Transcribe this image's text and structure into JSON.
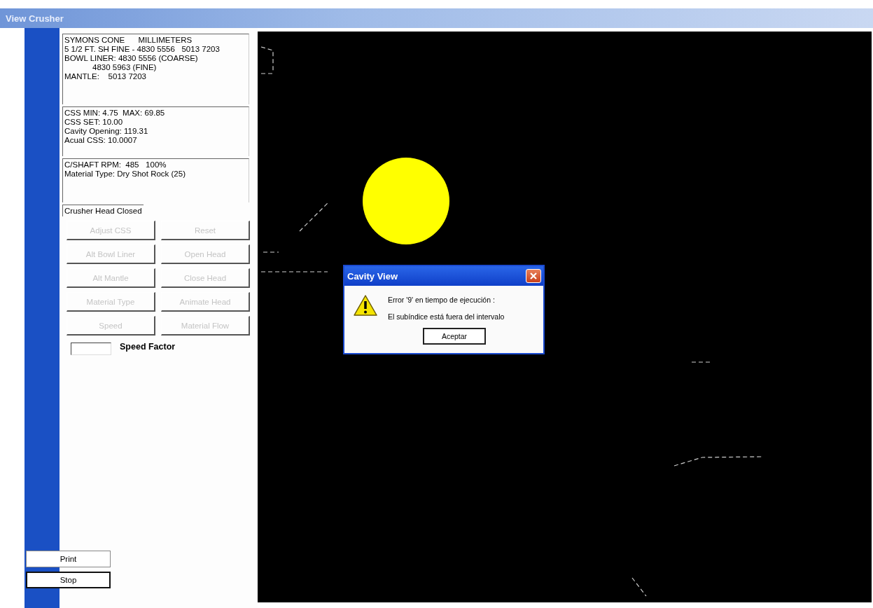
{
  "window": {
    "title": "View Crusher"
  },
  "info_groups": [
    {
      "lines": [
        {
          "text": "SYMONS CONE      MILLIMETERS",
          "indented": false
        },
        {
          "text": "5 1/2 FT. SH FINE - 4830 5556   5013 7203",
          "indented": false
        },
        {
          "text": "BOWL LINER: 4830 5556 (COARSE)",
          "indented": false
        },
        {
          "text": "4830 5963 (FINE)",
          "indented": true
        },
        {
          "text": "MANTLE:    5013 7203",
          "indented": false
        }
      ]
    },
    {
      "lines": [
        {
          "text": "CSS MIN: 4.75  MAX: 69.85",
          "indented": false
        },
        {
          "text": "CSS SET: 10.00",
          "indented": false
        },
        {
          "text": "Cavity Opening: 119.31",
          "indented": false
        },
        {
          "text": "Acual CSS: 10.0007",
          "indented": false
        }
      ]
    },
    {
      "lines": [
        {
          "text": "C/SHAFT RPM:  485   100%",
          "indented": false
        },
        {
          "text": "Material Type: Dry Shot Rock (25)",
          "indented": false
        }
      ]
    }
  ],
  "status": "Crusher Head Closed",
  "buttons": [
    {
      "label": "Adjust CSS",
      "disabled": true
    },
    {
      "label": "Reset",
      "disabled": true
    },
    {
      "label": "Alt Bowl Liner",
      "disabled": true
    },
    {
      "label": "Open Head",
      "disabled": true
    },
    {
      "label": "Alt Mantle",
      "disabled": true
    },
    {
      "label": "Close Head",
      "disabled": true
    },
    {
      "label": "Material Type",
      "disabled": true
    },
    {
      "label": "Animate Head",
      "disabled": true
    },
    {
      "label": "Speed",
      "disabled": true
    },
    {
      "label": "Material Flow",
      "disabled": true
    }
  ],
  "speed_factor": {
    "label": "Speed Factor"
  },
  "bottom_buttons": [
    {
      "label": "Print",
      "default": false
    },
    {
      "label": "Stop",
      "default": true
    }
  ],
  "dialog": {
    "title": "Cavity View",
    "messages": [
      "Error '9' en tiempo de ejecución :",
      "El subíndice está fuera del intervalo"
    ],
    "button": "Aceptar"
  }
}
